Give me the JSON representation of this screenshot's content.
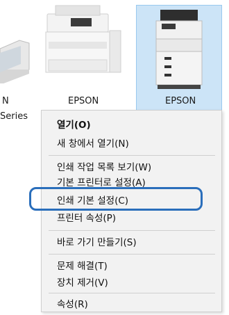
{
  "devices": [
    {
      "label_line1": "N",
      "label_line2": "Series"
    },
    {
      "label_line1": "EPSON"
    },
    {
      "label_line1": "EPSON"
    }
  ],
  "context_menu": {
    "items": [
      {
        "label": "열기(O)",
        "bold": true
      },
      {
        "label": "새 창에서 열기(N)"
      },
      {
        "label": "인쇄 작업 목록 보기(W)"
      },
      {
        "label": "기본 프린터로 설정(A)"
      },
      {
        "label": "인쇄 기본 설정(C)",
        "highlighted": true
      },
      {
        "label": "프린터 속성(P)"
      },
      {
        "label": "바로 가기 만들기(S)"
      },
      {
        "label": "문제 해결(T)"
      },
      {
        "label": "장치 제거(V)"
      },
      {
        "label": "속성(R)"
      }
    ]
  },
  "colors": {
    "selection_bg": "#cce4f7",
    "highlight_ring": "#2a6ebb"
  }
}
